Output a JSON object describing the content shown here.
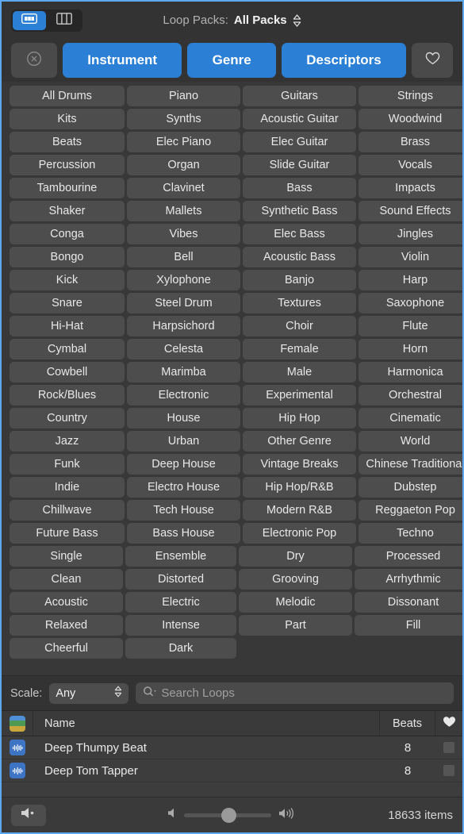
{
  "window": {
    "accent_blue": "#2b7fd4",
    "focus_ring": "#5ea8f0"
  },
  "topbar": {
    "view_grid_icon": "grid-view-icon",
    "view_column_icon": "column-view-icon",
    "loop_packs_label": "Loop Packs:",
    "loop_packs_value": "All Packs",
    "loop_packs_chevron_icon": "chevron-up-down-icon"
  },
  "tabbar": {
    "clear_icon": "clear-circle-x-icon",
    "tabs": [
      {
        "label": "Instrument",
        "selected": true
      },
      {
        "label": "Genre",
        "selected": true
      },
      {
        "label": "Descriptors",
        "selected": true
      }
    ],
    "favorites_icon": "heart-outline-icon"
  },
  "keyword_grid": {
    "groups": [
      {
        "name": "instrument-genre",
        "rows": [
          [
            "All Drums",
            "Piano",
            "Guitars",
            "Strings"
          ],
          [
            "Kits",
            "Synths",
            "Acoustic Guitar",
            "Woodwind"
          ],
          [
            "Beats",
            "Elec Piano",
            "Elec Guitar",
            "Brass"
          ],
          [
            "Percussion",
            "Organ",
            "Slide Guitar",
            "Vocals"
          ],
          [
            "Tambourine",
            "Clavinet",
            "Bass",
            "Impacts"
          ],
          [
            "Shaker",
            "Mallets",
            "Synthetic Bass",
            "Sound Effects"
          ],
          [
            "Conga",
            "Vibes",
            "Elec Bass",
            "Jingles"
          ],
          [
            "Bongo",
            "Bell",
            "Acoustic Bass",
            "Violin"
          ],
          [
            "Kick",
            "Xylophone",
            "Banjo",
            "Harp"
          ],
          [
            "Snare",
            "Steel Drum",
            "Textures",
            "Saxophone"
          ],
          [
            "Hi-Hat",
            "Harpsichord",
            "Choir",
            "Flute"
          ],
          [
            "Cymbal",
            "Celesta",
            "Female",
            "Horn"
          ],
          [
            "Cowbell",
            "Marimba",
            "Male",
            "Harmonica"
          ],
          [
            "Rock/Blues",
            "Electronic",
            "Experimental",
            "Orchestral"
          ],
          [
            "Country",
            "House",
            "Hip Hop",
            "Cinematic"
          ],
          [
            "Jazz",
            "Urban",
            "Other Genre",
            "World"
          ],
          [
            "Funk",
            "Deep House",
            "Vintage Breaks",
            "Chinese Traditional"
          ],
          [
            "Indie",
            "Electro House",
            "Hip Hop/R&B",
            "Dubstep"
          ],
          [
            "Chillwave",
            "Tech House",
            "Modern R&B",
            "Reggaeton Pop"
          ],
          [
            "Future Bass",
            "Bass House",
            "Electronic Pop",
            "Techno"
          ]
        ]
      },
      {
        "name": "descriptors",
        "rows": [
          [
            "Single",
            "Ensemble",
            "Dry",
            "Processed"
          ],
          [
            "Clean",
            "Distorted",
            "Grooving",
            "Arrhythmic"
          ],
          [
            "Acoustic",
            "Electric",
            "Melodic",
            "Dissonant"
          ],
          [
            "Relaxed",
            "Intense",
            "Part",
            "Fill"
          ],
          [
            "Cheerful",
            "Dark",
            "",
            ""
          ]
        ]
      }
    ]
  },
  "searchbar": {
    "scale_label": "Scale:",
    "scale_value": "Any",
    "scale_chevron_icon": "chevron-up-down-icon",
    "search_icon": "search-magnifier-icon",
    "search_value": "",
    "search_placeholder": "Search Loops"
  },
  "results": {
    "columns": {
      "icon": "loop-type-stack-icon",
      "name": "Name",
      "beats": "Beats",
      "favorite": "heart-filled-icon"
    },
    "rows": [
      {
        "icon": "waveform-loop-icon",
        "name": "Deep Thumpy Beat",
        "beats": "8"
      },
      {
        "icon": "waveform-loop-icon",
        "name": "Deep Tom Tapper",
        "beats": "8"
      }
    ]
  },
  "bottombar": {
    "preview_icon": "speaker-preview-icon",
    "volume_min_icon": "speaker-low-icon",
    "volume_max_icon": "speaker-high-icon",
    "volume_percent": 52,
    "item_count": "18633 items"
  }
}
